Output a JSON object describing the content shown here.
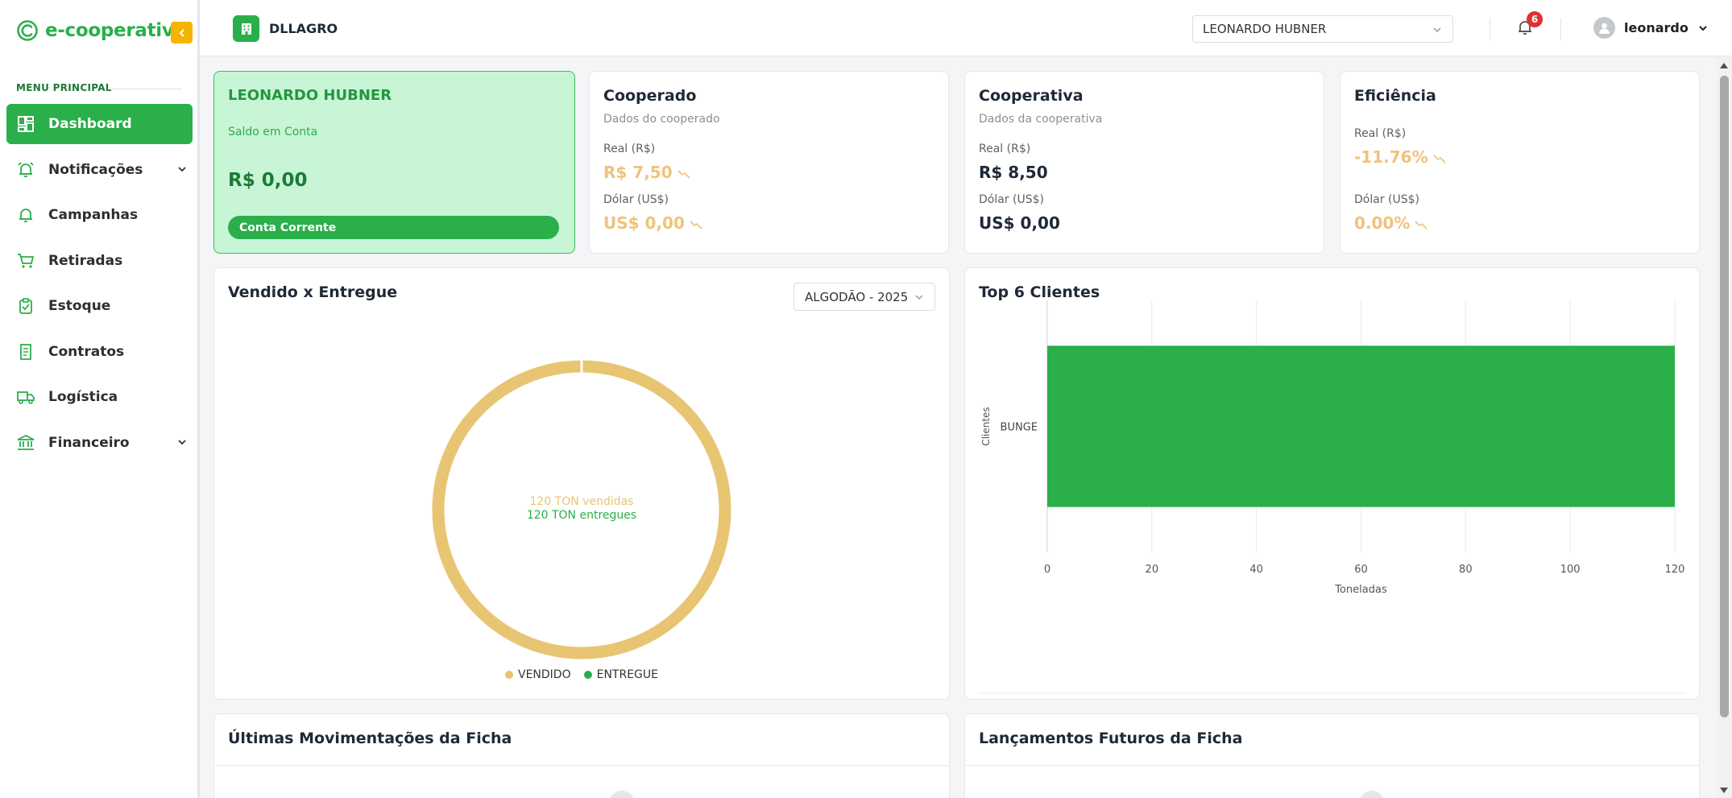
{
  "brand": {
    "name": "e-cooperativa",
    "color": "#2aaf4a"
  },
  "sidebar": {
    "menu_title": "MENU PRINCIPAL",
    "items": [
      {
        "label": "Dashboard",
        "icon": "dashboard-icon",
        "active": true
      },
      {
        "label": "Notificações",
        "icon": "alarm-icon",
        "has_submenu": true
      },
      {
        "label": "Campanhas",
        "icon": "bell-icon"
      },
      {
        "label": "Retiradas",
        "icon": "cart-icon"
      },
      {
        "label": "Estoque",
        "icon": "clipboard-check-icon"
      },
      {
        "label": "Contratos",
        "icon": "receipt-icon"
      },
      {
        "label": "Logística",
        "icon": "truck-icon"
      },
      {
        "label": "Financeiro",
        "icon": "bank-icon",
        "has_submenu": true
      }
    ]
  },
  "topbar": {
    "company": "DLLAGRO",
    "selected_user": "LEONARDO HUBNER",
    "notifications_count": "6",
    "account_name": "leonardo"
  },
  "balance_card": {
    "name": "LEONARDO HUBNER",
    "subtitle": "Saldo em Conta",
    "value": "R$ 0,00",
    "button": "Conta Corrente"
  },
  "cooperado_card": {
    "title": "Cooperado",
    "subtitle": "Dados do cooperado",
    "real_label": "Real (R$)",
    "real_value": "R$ 7,50",
    "dollar_label": "Dólar (US$)",
    "dollar_value": "US$ 0,00"
  },
  "cooperativa_card": {
    "title": "Cooperativa",
    "subtitle": "Dados da cooperativa",
    "real_label": "Real (R$)",
    "real_value": "R$ 8,50",
    "dollar_label": "Dólar (US$)",
    "dollar_value": "US$ 0,00"
  },
  "eficiencia_card": {
    "title": "Eficiência",
    "real_label": "Real (R$)",
    "real_value": "-11.76%",
    "dollar_label": "Dólar (US$)",
    "dollar_value": "0.00%"
  },
  "vendido_chart": {
    "title": "Vendido x Entregue",
    "filter": "ALGODÃO - 2025",
    "center_line1": "120 TON vendidas",
    "center_line2": "120 TON entregues",
    "legend": [
      "VENDIDO",
      "ENTREGUE"
    ],
    "colors": {
      "vendido": "#e8c572",
      "entregue": "#2aaf4a"
    }
  },
  "top_clients": {
    "title": "Top 6 Clientes"
  },
  "chart_data": [
    {
      "type": "pie",
      "title": "Vendido x Entregue",
      "categories": [
        "VENDIDO",
        "ENTREGUE"
      ],
      "values": [
        120,
        0
      ],
      "center_text": [
        "120 TON vendidas",
        "120 TON entregues"
      ]
    },
    {
      "type": "bar",
      "orientation": "horizontal",
      "title": "Top 6 Clientes",
      "categories": [
        "BUNGE"
      ],
      "values": [
        120
      ],
      "xlabel": "Toneladas",
      "ylabel": "Clientes",
      "xlim": [
        0,
        120
      ],
      "xticks": [
        0,
        20,
        40,
        60,
        80,
        100,
        120
      ],
      "grid": true,
      "color": "#2aaf4a"
    }
  ],
  "movements": {
    "title": "Últimas Movimentações da Ficha"
  },
  "future": {
    "title": "Lançamentos Futuros da Ficha"
  }
}
